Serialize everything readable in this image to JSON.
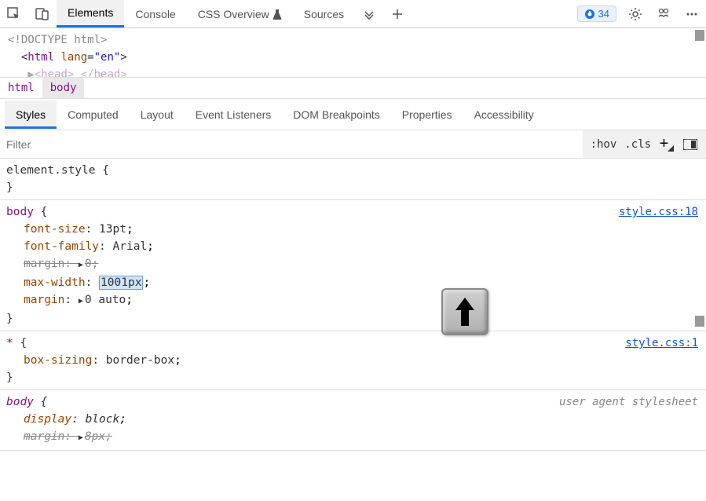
{
  "toolbar": {
    "tabs": [
      "Elements",
      "Console",
      "CSS Overview",
      "Sources"
    ],
    "active_tab_index": 0,
    "css_overview_beaker": "▲",
    "issues_count": "34"
  },
  "dom": {
    "line1": "<!DOCTYPE html>",
    "line2_tag": "html",
    "line2_attr": "lang",
    "line2_val": "\"en\"",
    "line3_head": "head"
  },
  "breadcrumb": {
    "items": [
      "html",
      "body"
    ],
    "active_index": 1
  },
  "subtabs": {
    "items": [
      "Styles",
      "Computed",
      "Layout",
      "Event Listeners",
      "DOM Breakpoints",
      "Properties",
      "Accessibility"
    ],
    "active_index": 0
  },
  "filter": {
    "placeholder": "Filter",
    "hov": ":hov",
    "cls": ".cls"
  },
  "rules": {
    "element_style": {
      "selector": "element.style",
      "open": "{",
      "close": "}"
    },
    "body_rule": {
      "selector": "body",
      "source": "style.css:18",
      "decls": {
        "font_size": {
          "prop": "font-size",
          "val": "13pt"
        },
        "font_family": {
          "prop": "font-family",
          "val": "Arial"
        },
        "margin_over": {
          "prop": "margin",
          "val": "0"
        },
        "max_width": {
          "prop": "max-width",
          "val": "1001px"
        },
        "margin": {
          "prop": "margin",
          "val": "0 auto"
        }
      }
    },
    "star_rule": {
      "selector": "*",
      "source": "style.css:1",
      "decl": {
        "prop": "box-sizing",
        "val": "border-box"
      }
    },
    "ua_body": {
      "selector": "body",
      "label": "user agent stylesheet",
      "display": {
        "prop": "display",
        "val": "block"
      },
      "margin": {
        "prop": "margin",
        "val": "8px"
      }
    }
  }
}
